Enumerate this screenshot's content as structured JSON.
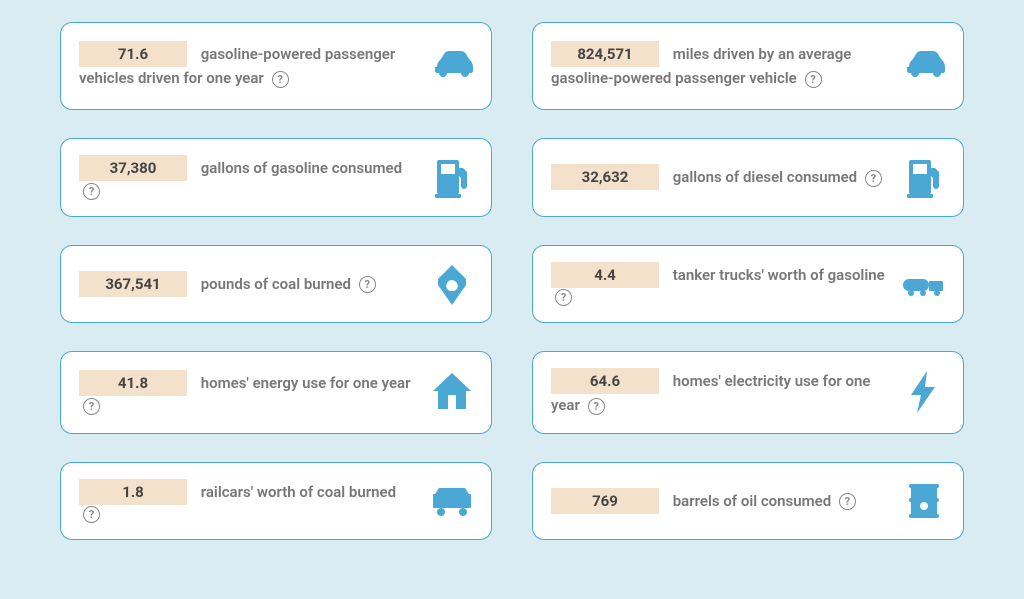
{
  "cards": [
    {
      "value": "71.6",
      "label": "gasoline-powered passenger vehicles driven for one year",
      "icon": "car"
    },
    {
      "value": "824,571",
      "label": "miles driven by an average gasoline-powered passenger vehicle",
      "icon": "car"
    },
    {
      "value": "37,380",
      "label": "gallons of gasoline consumed",
      "icon": "pump"
    },
    {
      "value": "32,632",
      "label": "gallons of diesel consumed",
      "icon": "pump"
    },
    {
      "value": "367,541",
      "label": "pounds of coal burned",
      "icon": "coal"
    },
    {
      "value": "4.4",
      "label": "tanker trucks' worth of gasoline",
      "icon": "truck"
    },
    {
      "value": "41.8",
      "label": "homes' energy use for one year",
      "icon": "house"
    },
    {
      "value": "64.6",
      "label": "homes' electricity use for one year",
      "icon": "bolt"
    },
    {
      "value": "1.8",
      "label": "railcars' worth of coal burned",
      "icon": "railcar"
    },
    {
      "value": "769",
      "label": "barrels of oil consumed",
      "icon": "barrel"
    }
  ],
  "help_glyph": "?"
}
